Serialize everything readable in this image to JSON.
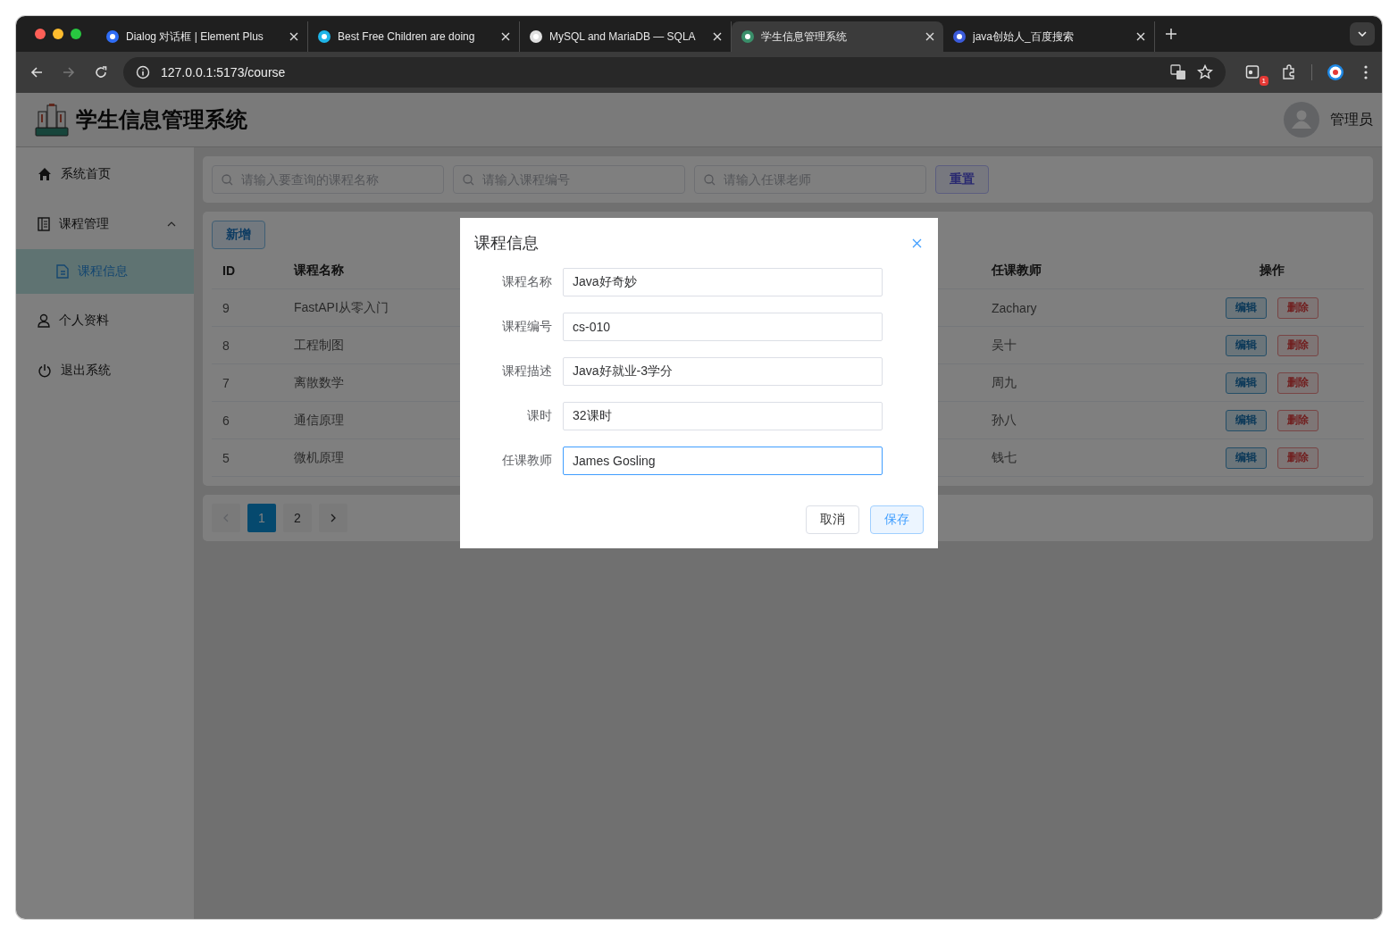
{
  "browser": {
    "tabs": [
      {
        "title": "Dialog 对话框 | Element Plus",
        "selected": false
      },
      {
        "title": "Best Free Children are doing",
        "selected": false
      },
      {
        "title": "MySQL and MariaDB — SQLA",
        "selected": false
      },
      {
        "title": "学生信息管理系统",
        "selected": true
      },
      {
        "title": "java创始人_百度搜索",
        "selected": false
      }
    ],
    "address": "127.0.0.1:5173/course",
    "extension_badge": "1"
  },
  "app": {
    "title": "学生信息管理系统",
    "user": "管理员",
    "sidebar": [
      {
        "label": "系统首页",
        "selected": false
      },
      {
        "label": "课程管理",
        "selected": false,
        "expanded": true,
        "children": [
          {
            "label": "课程信息",
            "selected": true
          }
        ]
      },
      {
        "label": "个人资料",
        "selected": false
      },
      {
        "label": "退出系统",
        "selected": false
      }
    ],
    "search": {
      "fields": [
        {
          "placeholder": "请输入要查询的课程名称"
        },
        {
          "placeholder": "请输入课程编号"
        },
        {
          "placeholder": "请输入任课老师"
        }
      ],
      "reset": "重置"
    },
    "add_button": "新增",
    "table": {
      "columns": [
        "ID",
        "课程名称",
        "任课教师",
        "操作"
      ],
      "rows": [
        {
          "id": "9",
          "name": "FastAPI从零入门",
          "teacher": "Zachary",
          "edit": "编辑",
          "delete": "删除"
        },
        {
          "id": "8",
          "name": "工程制图",
          "teacher": "吴十",
          "edit": "编辑",
          "delete": "删除"
        },
        {
          "id": "7",
          "name": "离散数学",
          "teacher": "周九",
          "edit": "编辑",
          "delete": "删除"
        },
        {
          "id": "6",
          "name": "通信原理",
          "teacher": "孙八",
          "edit": "编辑",
          "delete": "删除"
        },
        {
          "id": "5",
          "name": "微机原理",
          "teacher": "钱七",
          "edit": "编辑",
          "delete": "删除"
        }
      ]
    },
    "pagination": {
      "prev_disabled": true,
      "pages": [
        {
          "label": "1",
          "selected": true
        },
        {
          "label": "2",
          "selected": false
        }
      ]
    },
    "dialog": {
      "title": "课程信息",
      "fields": [
        {
          "label": "课程名称",
          "value": "Java好奇妙",
          "focused": false
        },
        {
          "label": "课程编号",
          "value": "cs-010",
          "focused": false
        },
        {
          "label": "课程描述",
          "value": "Java好就业-3学分",
          "focused": false
        },
        {
          "label": "课时",
          "value": "32课时",
          "focused": false
        },
        {
          "label": "任课教师",
          "value": "James Gosling",
          "focused": true
        }
      ],
      "cancel": "取消",
      "save": "保存"
    }
  }
}
